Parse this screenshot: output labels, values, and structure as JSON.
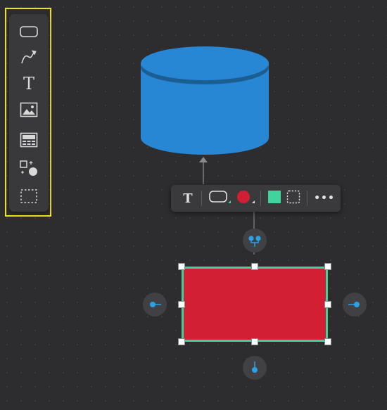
{
  "left_toolbar": {
    "tools": [
      {
        "name": "rounded-rectangle-tool",
        "icon": "rounded-rectangle-icon"
      },
      {
        "name": "connector-tool",
        "icon": "curved-arrow-icon"
      },
      {
        "name": "text-tool",
        "icon": "text-icon",
        "glyph": "T"
      },
      {
        "name": "image-tool",
        "icon": "image-icon"
      },
      {
        "name": "template-tool",
        "icon": "template-icon"
      },
      {
        "name": "shapes-tool",
        "icon": "shapes-icon"
      },
      {
        "name": "frame-tool",
        "icon": "dashed-frame-icon"
      }
    ],
    "highlight_color": "#f2e21a"
  },
  "context_toolbar": {
    "text_glyph": "T",
    "items": [
      "text-format",
      "shape-style",
      "stroke-color",
      "fill-color",
      "border-style",
      "more-options"
    ],
    "more_glyph": "•••",
    "stroke_color": "#d31f34",
    "fill_color": "#41d39c"
  },
  "canvas": {
    "cylinder_color": "#2787d4",
    "rectangle_fill": "#d31f34",
    "rectangle_border": "#41d39c",
    "connector_dot_color": "#29a3e6",
    "background": "#2d2d2f"
  }
}
